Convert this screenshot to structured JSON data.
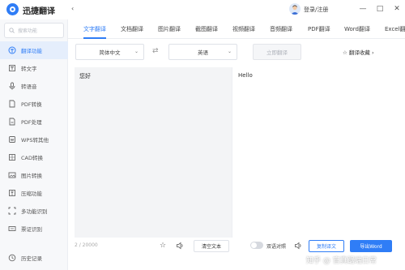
{
  "app": {
    "title": "迅捷翻译",
    "login": "登录/注册"
  },
  "window": {
    "minimize": "—",
    "maximize": "□",
    "close": "✕"
  },
  "sidebar": {
    "search_placeholder": "搜索功能",
    "items": [
      {
        "label": "翻译功能",
        "icon": "translate-icon",
        "active": true
      },
      {
        "label": "转文字",
        "icon": "text-icon"
      },
      {
        "label": "转语音",
        "icon": "voice-icon"
      },
      {
        "label": "PDF转换",
        "icon": "pdf-convert-icon"
      },
      {
        "label": "PDF处理",
        "icon": "pdf-process-icon"
      },
      {
        "label": "WPS转其他",
        "icon": "wps-icon"
      },
      {
        "label": "CAD转换",
        "icon": "cad-icon"
      },
      {
        "label": "图片转换",
        "icon": "image-icon"
      },
      {
        "label": "压缩功能",
        "icon": "compress-icon"
      },
      {
        "label": "多功能识别",
        "icon": "recognize-icon"
      },
      {
        "label": "票证识别",
        "icon": "ticket-icon"
      },
      {
        "label": "历史记录",
        "icon": "history-icon"
      }
    ]
  },
  "tabs": [
    "文字翻译",
    "文档翻译",
    "图片翻译",
    "截图翻译",
    "视频翻译",
    "音频翻译",
    "PDF翻译",
    "Word翻译",
    "Excel翻"
  ],
  "toolbar": {
    "source_lang": "简体中文",
    "target_lang": "英语",
    "translate_button": "立即翻译",
    "favorites": "翻译收藏"
  },
  "editor": {
    "source_text": "您好",
    "target_text": "Hello",
    "counter": "2 / 20000"
  },
  "bottom": {
    "clear_button": "清空文本",
    "bilingual": "双语对照",
    "copy_button": "复制译文",
    "export_button": "导出Word"
  },
  "watermark": "知乎 @ 官真踞端日常",
  "colors": {
    "accent": "#2f7df6"
  }
}
